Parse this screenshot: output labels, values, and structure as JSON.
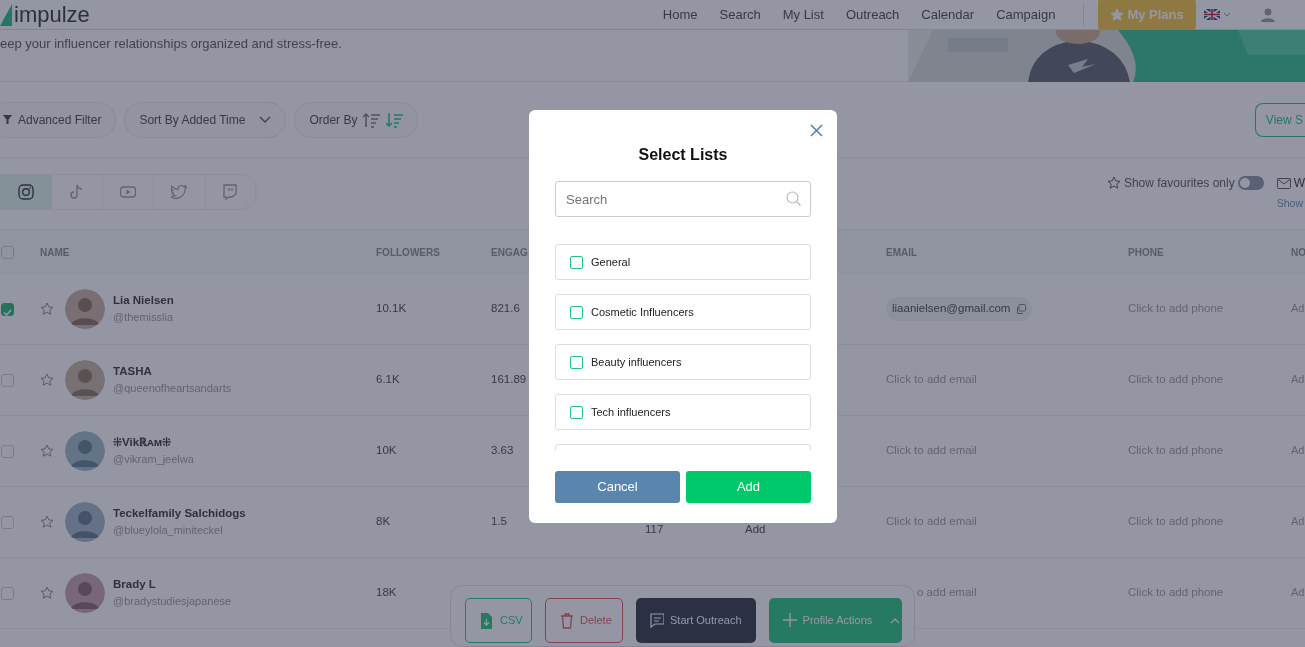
{
  "header": {
    "logo": "impulze",
    "nav": [
      {
        "label": "Home",
        "selected": false
      },
      {
        "label": "Search",
        "selected": false
      },
      {
        "label": "My List",
        "selected": false
      },
      {
        "label": "Outreach",
        "selected": false
      },
      {
        "label": "Calendar",
        "selected": false
      },
      {
        "label": "Campaign",
        "selected": false
      }
    ],
    "plans_button": "My Plans"
  },
  "hero": {
    "subtitle": "eep your influencer relationships organized and stress-free.",
    "kind": "picture"
  },
  "toolbar": {
    "filter": "Advanced Filter",
    "sort": "Sort By Added Time",
    "order_label": "Order By",
    "order": [
      {
        "kind": "ascending",
        "selected": false
      },
      {
        "kind": "descending",
        "selected": true
      }
    ],
    "view_button": "View S"
  },
  "platforms": [
    {
      "kind": "instagram",
      "selected": true
    },
    {
      "kind": "tiktok",
      "selected": false
    },
    {
      "kind": "youtube",
      "selected": false
    },
    {
      "kind": "twitter",
      "selected": false
    },
    {
      "kind": "twitch",
      "selected": false
    }
  ],
  "favourites": {
    "label": "Show favourites only",
    "on": false,
    "mail_label": "W",
    "show_link": "Show"
  },
  "table": {
    "all_selected": false,
    "columns": [
      "NAME",
      "FOLLOWERS",
      "ENGAG",
      "EMAIL",
      "PHONE",
      "NO"
    ],
    "rows": [
      {
        "selected": true,
        "favourite": false,
        "name": "Lia Nielsen",
        "handle": "@themisslia",
        "followers": "10.1K",
        "engagement": "821.6",
        "email": {
          "kind": "chip",
          "text": "liaanielsen@gmail.com"
        },
        "phone": "Click to add phone",
        "notes": "Ad"
      },
      {
        "selected": false,
        "favourite": false,
        "name": "TASHA",
        "handle": "@queenofheartsandarts",
        "followers": "6.1K",
        "engagement": "161.89",
        "email": {
          "kind": "empty",
          "text": "Click to add email"
        },
        "phone": "Click to add phone",
        "notes": "Ad"
      },
      {
        "selected": false,
        "favourite": false,
        "name": "⁜Vikℝᴀᴍ⁜",
        "handle": "@vikram_jeelwa",
        "followers": "10K",
        "engagement": "3.63",
        "email": {
          "kind": "empty",
          "text": "Click to add email"
        },
        "phone": "Click to add phone",
        "notes": "Ad"
      },
      {
        "selected": false,
        "favourite": false,
        "name": "Teckelfamily Salchidogs",
        "handle": "@blueylola_miniteckel",
        "followers": "8K",
        "engagement": "1.5",
        "column_5": "117",
        "column_6": "Add",
        "email": {
          "kind": "empty",
          "text": "Click to add email"
        },
        "phone": "Click to add phone",
        "notes": "Ad"
      },
      {
        "selected": false,
        "favourite": false,
        "name": "Brady L",
        "handle": "@bradystudiesjapanese",
        "followers": "18K",
        "email": {
          "kind": "empty",
          "text": "o add email"
        },
        "phone": "Click to add phone",
        "notes": "Ad"
      }
    ]
  },
  "action_bar": [
    {
      "kind": "csv",
      "label": "CSV"
    },
    {
      "kind": "delete",
      "label": "Delete"
    },
    {
      "kind": "outreach",
      "label": "Start Outreach"
    },
    {
      "kind": "profile",
      "label": "Profile Actions"
    }
  ],
  "modal": {
    "title": "Select Lists",
    "search_placeholder": "Search",
    "lists": [
      {
        "label": "General",
        "checked": false
      },
      {
        "label": "Cosmetic Influencers",
        "checked": false
      },
      {
        "label": "Beauty influencers",
        "checked": false
      },
      {
        "label": "Tech influencers",
        "checked": false
      }
    ],
    "more_below": true,
    "cancel": "Cancel",
    "add": "Add"
  }
}
